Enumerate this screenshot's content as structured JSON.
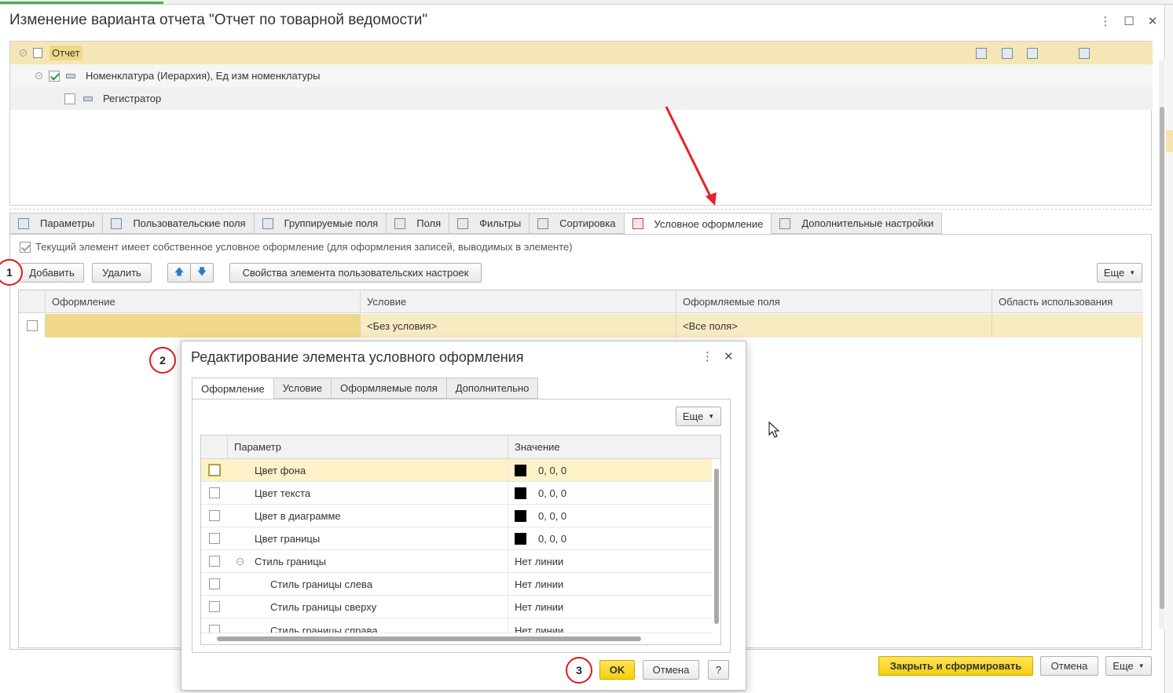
{
  "window": {
    "title": "Изменение варианта отчета \"Отчет по товарной ведомости\"",
    "controls": {
      "more": "⋮",
      "maximize": "☐",
      "close": "✕"
    }
  },
  "tree": {
    "rows": [
      {
        "label": "Отчет",
        "checked": null
      },
      {
        "label": "Номенклатура (Иерархия), Ед изм номенклатуры",
        "checked": true
      },
      {
        "label": "Регистратор",
        "checked": false
      }
    ]
  },
  "tabs": [
    {
      "label": "Параметры",
      "icon": "table-icon"
    },
    {
      "label": "Пользовательские поля",
      "icon": "formula-icon"
    },
    {
      "label": "Группируемые поля",
      "icon": "table-icon"
    },
    {
      "label": "Поля",
      "icon": "list-icon"
    },
    {
      "label": "Фильтры",
      "icon": "filter-icon"
    },
    {
      "label": "Сортировка",
      "icon": "sort-icon"
    },
    {
      "label": "Условное оформление",
      "icon": "brush-icon",
      "active": true
    },
    {
      "label": "Дополнительные настройки",
      "icon": "settings-icon"
    }
  ],
  "conditional": {
    "own_checkbox_label": "Текущий элемент имеет собственное условное оформление (для оформления записей, выводимых в элементе)",
    "buttons": {
      "add": "Добавить",
      "delete": "Удалить",
      "up": "🡅",
      "down": "🡇",
      "props": "Свойства элемента пользовательских настроек",
      "more": "Еще"
    },
    "columns": [
      "Оформление",
      "Условие",
      "Оформляемые поля",
      "Область использования"
    ],
    "rows": [
      {
        "format": "",
        "condition": "<Без условия>",
        "fields": "<Все поля>",
        "area": ""
      }
    ]
  },
  "main_buttons": {
    "close_and_build": "Закрыть и сформировать",
    "cancel": "Отмена",
    "more": "Еще"
  },
  "dialog": {
    "title": "Редактирование элемента условного оформления",
    "tabs": [
      "Оформление",
      "Условие",
      "Оформляемые поля",
      "Дополнительно"
    ],
    "more": "Еще",
    "columns": [
      "Параметр",
      "Значение"
    ],
    "rows": [
      {
        "param": "Цвет фона",
        "value": "0, 0, 0",
        "swatch": "#000000",
        "indent": 0
      },
      {
        "param": "Цвет текста",
        "value": "0, 0, 0",
        "swatch": "#000000",
        "indent": 0
      },
      {
        "param": "Цвет в диаграмме",
        "value": "0, 0, 0",
        "swatch": "#000000",
        "indent": 0
      },
      {
        "param": "Цвет границы",
        "value": "0, 0, 0",
        "swatch": "#000000",
        "indent": 0
      },
      {
        "param": "Стиль границы",
        "value": "Нет линии",
        "indent": 0,
        "group": true
      },
      {
        "param": "Стиль границы слева",
        "value": "Нет линии",
        "indent": 1
      },
      {
        "param": "Стиль границы сверху",
        "value": "Нет линии",
        "indent": 1
      },
      {
        "param": "Стиль границы справа",
        "value": "Нет линии",
        "indent": 1
      }
    ],
    "buttons": {
      "ok": "OK",
      "cancel": "Отмена",
      "help": "?"
    }
  },
  "markers": [
    "1",
    "2",
    "3"
  ],
  "colors": {
    "accent": "#f5cf0a",
    "selection": "#f7ebc2",
    "marker": "#e01818",
    "arrow": "#e8202a"
  }
}
